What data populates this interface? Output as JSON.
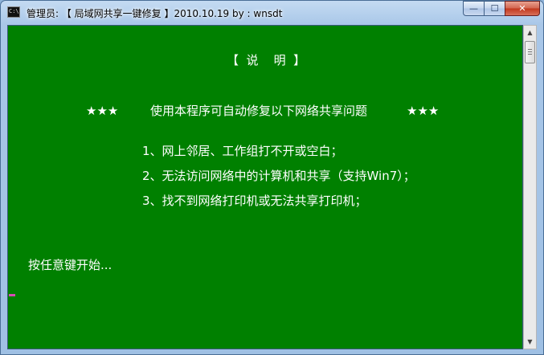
{
  "window": {
    "title": "管理员:  【 局域网共享一键修复 】2010.10.19    by : wnsdt",
    "icon": "cmd-console-icon",
    "icon_text": "C:\\",
    "buttons": {
      "minimize": "—",
      "maximize": "☐",
      "close": "✕"
    }
  },
  "console": {
    "background": "#008000",
    "foreground": "#ffffff",
    "heading": "【  说    明  】",
    "stars_left": "★★★",
    "intro": "使用本程序可自动修复以下网络共享问题",
    "stars_right": "★★★",
    "items": [
      "1、网上邻居、工作组打不开或空白；",
      "2、无法访问网络中的计算机和共享（支持Win7）；",
      "3、找不到网络打印机或无法共享打印机；"
    ],
    "prompt": "按任意键开始..."
  },
  "scrollbar": {
    "up": "▲",
    "down": "▼"
  }
}
